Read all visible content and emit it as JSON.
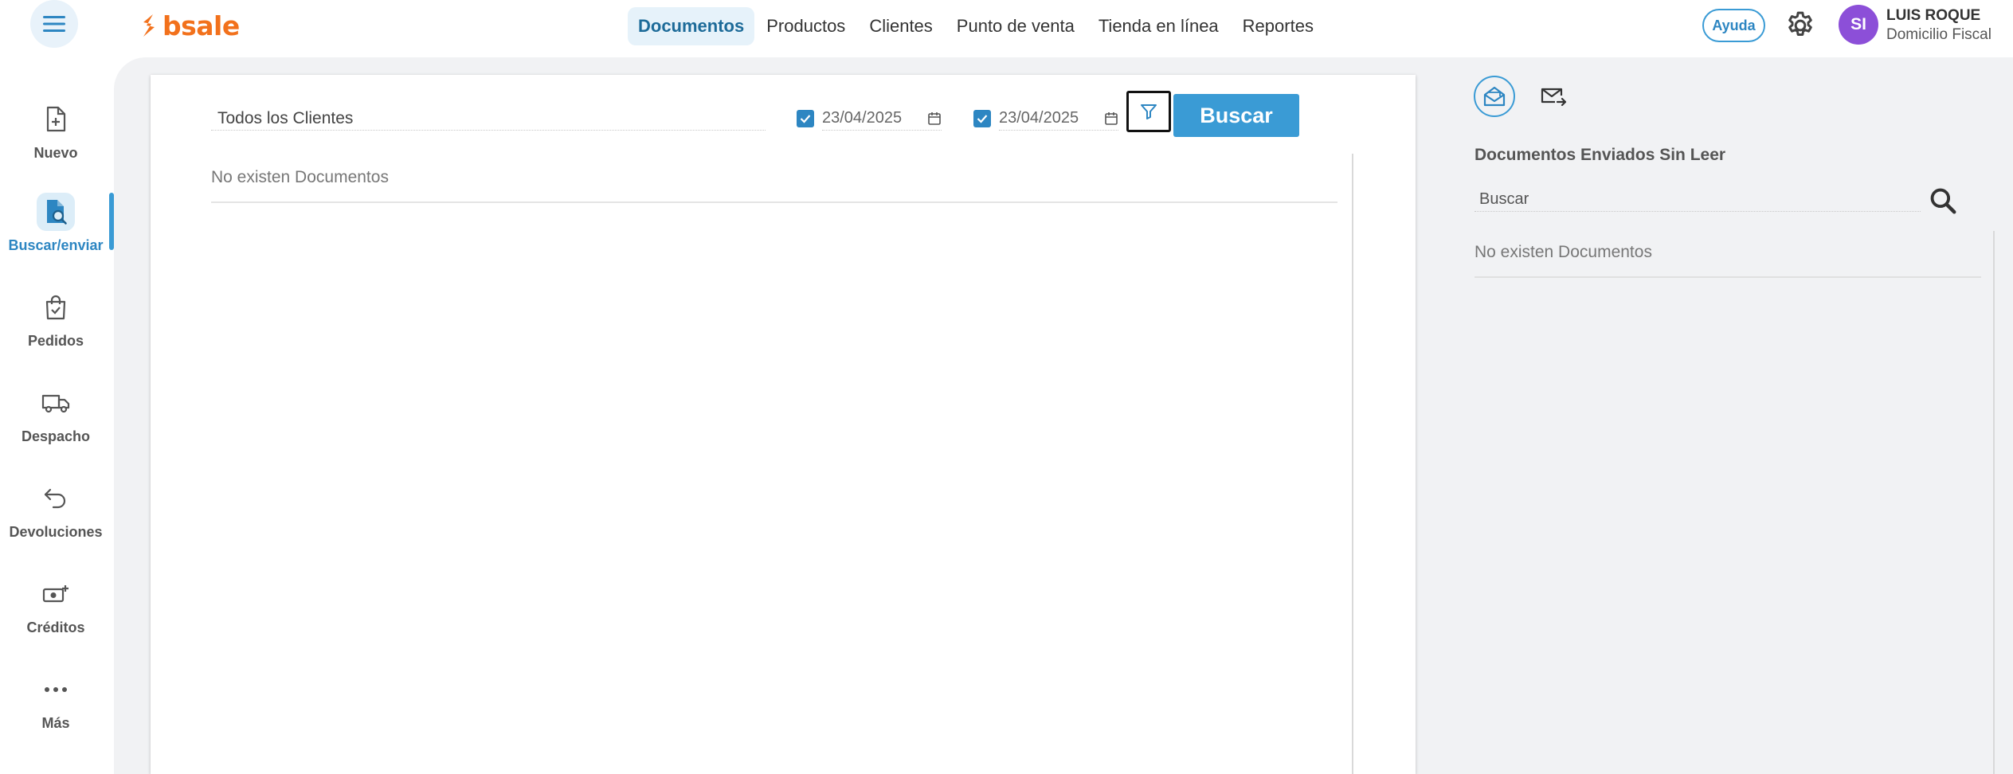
{
  "header": {
    "logo_text": "bsale",
    "nav": [
      {
        "label": "Documentos",
        "active": true
      },
      {
        "label": "Productos"
      },
      {
        "label": "Clientes"
      },
      {
        "label": "Punto de venta"
      },
      {
        "label": "Tienda en línea"
      },
      {
        "label": "Reportes"
      }
    ],
    "help_label": "Ayuda",
    "user": {
      "initials": "SI",
      "name": "LUIS ROQUE",
      "subtitle": "Domicilio Fiscal"
    }
  },
  "sidebar": {
    "items": [
      {
        "label": "Nuevo",
        "icon": "file-plus-icon"
      },
      {
        "label": "Buscar/enviar",
        "icon": "file-search-icon",
        "active": true
      },
      {
        "label": "Pedidos",
        "icon": "shopping-bag-icon"
      },
      {
        "label": "Despacho",
        "icon": "truck-icon"
      },
      {
        "label": "Devoluciones",
        "icon": "return-arrow-icon"
      },
      {
        "label": "Créditos",
        "icon": "cash-plus-icon"
      },
      {
        "label": "Más",
        "icon": "more-dots-icon"
      }
    ]
  },
  "filters": {
    "client_value": "Todos los Clientes",
    "date_from": "23/04/2025",
    "date_to": "23/04/2025",
    "search_label": "Buscar"
  },
  "main": {
    "empty_message": "No existen Documentos"
  },
  "side_panel": {
    "title": "Documentos Enviados Sin Leer",
    "search_placeholder": "Buscar",
    "empty_message": "No existen Documentos"
  },
  "colors": {
    "accent": "#3a9bd5",
    "brand": "#f2711c",
    "avatar": "#8c4fd8"
  }
}
